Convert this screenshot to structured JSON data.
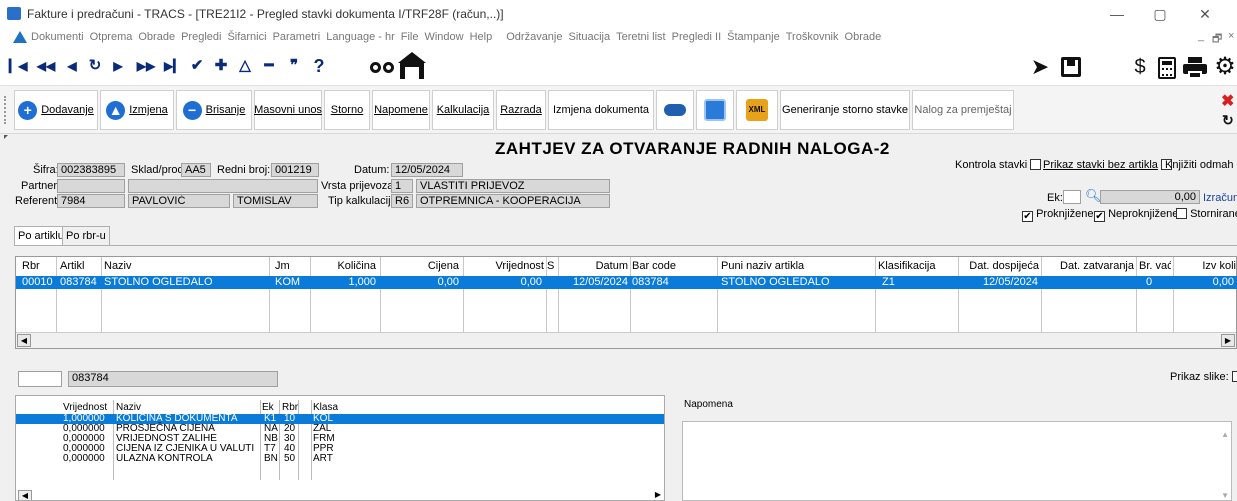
{
  "window": {
    "title": "Fakture i predračuni - TRACS - [TRE21I2 - Pregled stavki dokumenta I/TRF28F (račun,..)]",
    "minimize": "—",
    "restore": "▢",
    "close": "✕"
  },
  "menu": {
    "items": [
      "Dokumenti",
      "Otprema",
      "Obrade",
      "Pregledi",
      "Šifarnici",
      "Parametri",
      "Language - hr",
      "File",
      "Window",
      "Help",
      "Održavanje",
      "Situacija",
      "Teretni list",
      "Pregledi II",
      "Štampanje",
      "Troškovnik",
      "Obrade"
    ],
    "mdi_min": "_",
    "mdi_restore": "🗗",
    "mdi_close": "×"
  },
  "nav": {
    "first": "◀◀",
    "prev_fast": "◀◀",
    "prev": "◀",
    "refresh": "↻",
    "next": "▶",
    "next_fast": "▶▶",
    "last": "▶▶",
    "confirm": "✔",
    "add": "✚",
    "up": "△",
    "remove": "━",
    "quote": "❞",
    "help": "?"
  },
  "actions": {
    "add": "Dodavanje",
    "edit": "Izmjena",
    "delete": "Brisanje",
    "bulk": "Masovni unos",
    "storno": "Storno",
    "notes": "Napomene",
    "calc": "Kalkulacija",
    "split": "Razrada",
    "change_doc": "Izmjena dokumenta",
    "gen_storno": "Generiranje storno stavke",
    "transfer": "Nalog za premještaj"
  },
  "doc": {
    "title": "ZAHTJEV ZA OTVARANJE RADNIH NALOGA-2",
    "sifra_label": "Šifra:",
    "sifra": "002383895",
    "sklad_label": "Sklad/prod:",
    "sklad": "AA5",
    "rbr_label": "Redni broj:",
    "rbr": "001219",
    "datum_label": "Datum:",
    "datum": "12/05/2024",
    "partner_label": "Partner:",
    "partner_code": "",
    "partner_name": "",
    "vrsta_label": "Vrsta prijevoza:",
    "vrsta_code": "1",
    "vrsta_name": "VLASTITI PRIJEVOZ",
    "referent_label": "Referent:",
    "referent_code": "7984",
    "referent_last": "PAVLOVIĆ",
    "referent_first": "TOMISLAV",
    "tip_label": "Tip kalkulacije:",
    "tip_code": "R6",
    "tip_name": "OTPREMNICA - KOOPERACIJA"
  },
  "options": {
    "kontrola": "Kontrola stavki",
    "prikaz": "Prikaz stavki bez artikla",
    "knjiziti": "Knjižiti odmah",
    "ek_label": "Ek:",
    "ek_value": "",
    "amount": "0,00",
    "calc_link": "Izračunaj",
    "proknjizene": "Proknjižene",
    "neproknjizene": "Neproknjižene",
    "stornirane": "Stornirane",
    "checked": "✔"
  },
  "tabs": [
    "Po artiklu",
    "Po rbr-u"
  ],
  "grid": {
    "headers": [
      "Rbr",
      "Artikl",
      "Naziv",
      "Jm",
      "Količina",
      "Cijena",
      "Vrijednost",
      "S",
      "Datum",
      "Bar code",
      "Puni naziv artikla",
      "Klasifikacija",
      "Dat. dospijeća",
      "Dat. zatvaranja",
      "Br. vać",
      "Izv koli"
    ],
    "row": [
      "00010",
      "083784",
      "STOLNO OGLEDALO",
      "KOM",
      "1,000",
      "0,00",
      "0,00",
      "",
      "12/05/2024",
      "083784",
      "STOLNO OGLEDALO",
      "Z1",
      "12/05/2024",
      "",
      "0",
      "0,00"
    ]
  },
  "below_grid": {
    "box1": "",
    "box2": "083784",
    "prikaz_slike": "Prikaz slike:"
  },
  "bottom_list": {
    "headers": [
      "Vrijednost",
      "Naziv",
      "Ek",
      "Rbr",
      "Klasa"
    ],
    "rows": [
      [
        "1,000000",
        "KOLIČINA S DOKUMENTA",
        "K1",
        "10",
        "KOL"
      ],
      [
        "0,000000",
        "PROSJEČNA CIJENA",
        "NA",
        "20",
        "ZAL"
      ],
      [
        "0,000000",
        "VRIJEDNOST ZALIHE",
        "NB",
        "30",
        "FRM"
      ],
      [
        "0,000000",
        "CIJENA IZ CJENIKA U VALUTI",
        "T7",
        "40",
        "PPR"
      ],
      [
        "0,000000",
        "ULAZNA KONTROLA",
        "BN",
        "50",
        "ART"
      ]
    ]
  },
  "notes": {
    "label": "Napomena"
  }
}
